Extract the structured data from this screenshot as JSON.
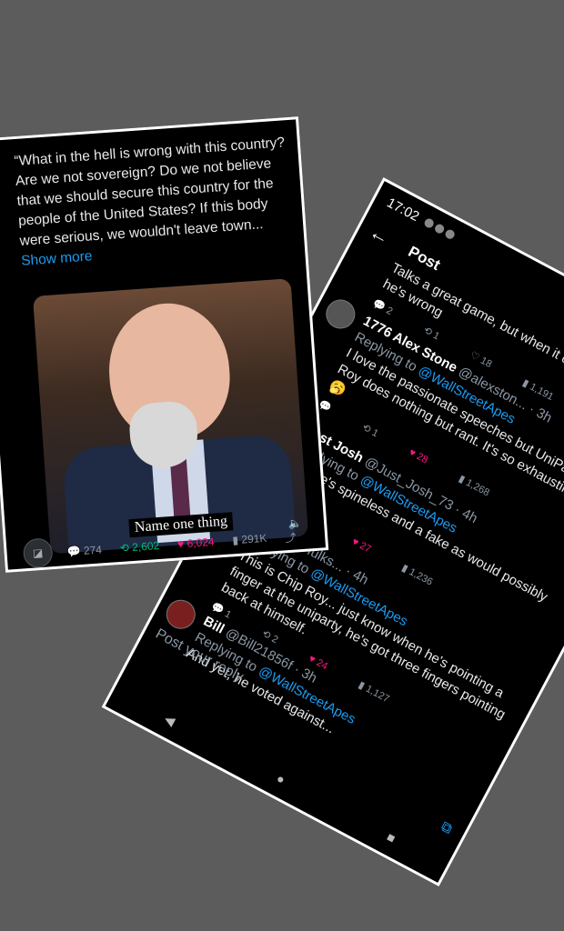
{
  "phone": {
    "time": "17:02",
    "header_title": "Post",
    "tweets": [
      {
        "fragment": "Talks a great game, but when it comes down to a vote he's wrong",
        "actions": {
          "replies": "2",
          "retweets": "1",
          "likes": "18",
          "views": "1,191"
        }
      },
      {
        "name": "1776 Alex Stone",
        "handle": "@alexston...",
        "time": "· 3h",
        "replying": "Replying to",
        "mention": "@WallStreetApes",
        "text": "I love the passionate speeches but UniParty Chip Roy does nothing but rant. It's so exhausting! 🥱🥱🥱",
        "actions": {
          "replies": "",
          "retweets": "1",
          "likes": "28",
          "views": "1,268"
        }
      },
      {
        "name": "Just Josh",
        "handle": "@Just_Josh_73",
        "time": "· 4h",
        "replying": "Replying to",
        "mention": "@WallStreetApes",
        "text": "And he's spineless and a fake as would possibly mean",
        "actions": {
          "replies": "",
          "retweets": "",
          "likes": "27",
          "views": "1,236"
        }
      },
      {
        "name": "",
        "handle": "@TaylorTfulks...",
        "time": "· 4h",
        "replying": "Replying to",
        "mention": "@WallStreetApes",
        "text": "This is Chip Roy... just know when he's pointing a finger at the uniparty, he's got three fingers pointing back at himself.",
        "actions": {
          "replies": "1",
          "retweets": "2",
          "likes": "24",
          "views": "1,127"
        }
      },
      {
        "name": "Bill",
        "handle": "@Bill21856f",
        "time": "· 3h",
        "replying": "Replying to",
        "mention": "@WallStreetApes",
        "text": "And yet, he voted against..."
      }
    ],
    "post_reply_placeholder": "Post your reply"
  },
  "card": {
    "quote": "“What in the hell is wrong with this country? Are we not sovereign? Do we not believe that we should secure this country for the people of the United States? If this body were serious, we wouldn't leave town...",
    "show_more": "Show more",
    "video_caption": "Name one thing",
    "stats": {
      "replies": "274",
      "retweets": "2,602",
      "likes": "6,024",
      "views": "291K"
    }
  }
}
